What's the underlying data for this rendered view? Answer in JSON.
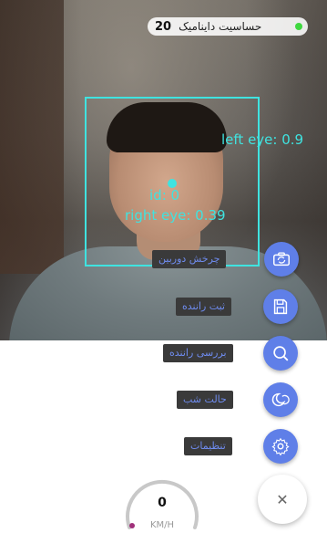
{
  "camera": {
    "labels": {
      "left_eye": "left eye: 0.9",
      "id": "id: 0",
      "right_eye": "right eye: 0.39"
    }
  },
  "sensitivity": {
    "label": "حساسیت داینامیک",
    "value": "20",
    "status_color": "#3fd83f"
  },
  "actions": [
    {
      "label": "چرخش دوربین",
      "icon": "camera-rotate-icon"
    },
    {
      "label": "ثبت راننده",
      "icon": "save-icon"
    },
    {
      "label": "بررسی راننده",
      "icon": "search-icon"
    },
    {
      "label": "حالت شب",
      "icon": "night-mode-icon"
    },
    {
      "label": "تنظیمات",
      "icon": "settings-icon"
    }
  ],
  "close_button": {
    "icon": "close-icon",
    "glyph": "✕"
  },
  "speedometer": {
    "value": "0",
    "unit": "KM/H"
  },
  "colors": {
    "accent": "#5f7fe8",
    "face_box": "#3fe3e0",
    "label_bg": "#3a3a3a",
    "label_text": "#6f8cf0"
  }
}
